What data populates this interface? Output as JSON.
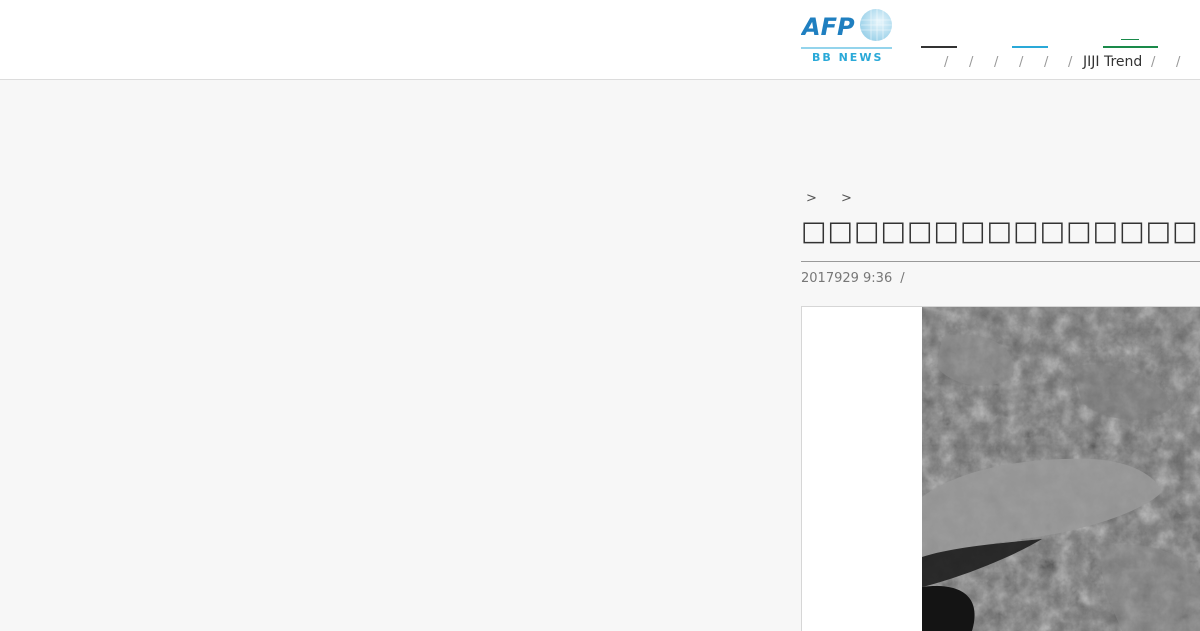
{
  "header": {
    "logo": {
      "brand_text": "AFP",
      "sub_text": "BB NEWS"
    },
    "nav": {
      "separator": "/",
      "trend_label": "JIJI Trend"
    }
  },
  "breadcrumb": {
    "separator": ">"
  },
  "article": {
    "title": "□□□□□□□□□□□□□□□□□ESA□",
    "date": "2017929 9:36",
    "meta_separator": "/"
  },
  "colors": {
    "header_bg": "#ffffff",
    "page_bg": "#f7f7f7",
    "accent_blue": "#2aa9d8",
    "accent_green": "#1a8a4a",
    "text_dark": "#333333"
  }
}
